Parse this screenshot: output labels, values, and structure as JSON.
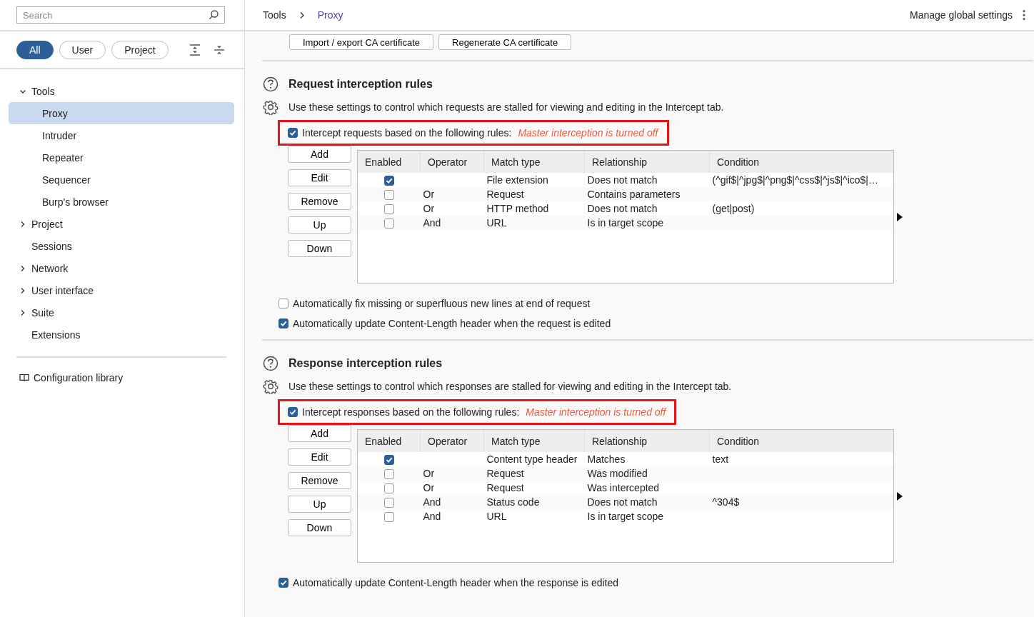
{
  "sidebar": {
    "search": {
      "placeholder": "Search"
    },
    "filters": [
      {
        "label": "All",
        "selected": true
      },
      {
        "label": "User",
        "selected": false
      },
      {
        "label": "Project",
        "selected": false
      }
    ],
    "tree": [
      {
        "label": "Tools",
        "expanded": true,
        "selected": false,
        "children": [
          {
            "label": "Proxy",
            "selected": true
          },
          {
            "label": "Intruder",
            "selected": false
          },
          {
            "label": "Repeater",
            "selected": false
          },
          {
            "label": "Sequencer",
            "selected": false
          },
          {
            "label": "Burp's browser",
            "selected": false
          }
        ]
      },
      {
        "label": "Project",
        "expanded": false,
        "selected": false
      },
      {
        "label": "Sessions",
        "selected": false
      },
      {
        "label": "Network",
        "expanded": false,
        "selected": false
      },
      {
        "label": "User interface",
        "expanded": false,
        "selected": false
      },
      {
        "label": "Suite",
        "expanded": false,
        "selected": false
      },
      {
        "label": "Extensions",
        "selected": false
      }
    ],
    "footer_link": "Configuration library"
  },
  "breadcrumb": [
    "Tools",
    "Proxy"
  ],
  "manage_link": "Manage global settings",
  "top_buttons": [
    "Import / export CA certificate",
    "Regenerate CA certificate"
  ],
  "sections": [
    {
      "title": "Request interception rules",
      "description": "Use these settings to control which requests are stalled for viewing and editing in the Intercept tab.",
      "intercept": {
        "label": "Intercept requests based on the following rules:",
        "checked": true,
        "note": "Master interception is turned off"
      },
      "buttons": [
        "Add",
        "Edit",
        "Remove",
        "Up",
        "Down"
      ],
      "columns": [
        "Enabled",
        "Operator",
        "Match type",
        "Relationship",
        "Condition"
      ],
      "rows": [
        {
          "enabled": true,
          "operator": "",
          "match_type": "File extension",
          "relationship": "Does not match",
          "condition": "(^gif$|^jpg$|^png$|^css$|^js$|^ico$|…"
        },
        {
          "enabled": false,
          "operator": "Or",
          "match_type": "Request",
          "relationship": "Contains parameters",
          "condition": ""
        },
        {
          "enabled": false,
          "operator": "Or",
          "match_type": "HTTP method",
          "relationship": "Does not match",
          "condition": "(get|post)"
        },
        {
          "enabled": false,
          "operator": "And",
          "match_type": "URL",
          "relationship": "Is in target scope",
          "condition": ""
        }
      ],
      "options": [
        {
          "label": "Automatically fix missing or superfluous new lines at end of request",
          "checked": false
        },
        {
          "label": "Automatically update Content-Length header when the request is edited",
          "checked": true
        }
      ]
    },
    {
      "title": "Response interception rules",
      "description": "Use these settings to control which responses are stalled for viewing and editing in the Intercept tab.",
      "intercept": {
        "label": "Intercept responses based on the following rules:",
        "checked": true,
        "note": "Master interception is turned off"
      },
      "buttons": [
        "Add",
        "Edit",
        "Remove",
        "Up",
        "Down"
      ],
      "columns": [
        "Enabled",
        "Operator",
        "Match type",
        "Relationship",
        "Condition"
      ],
      "rows": [
        {
          "enabled": true,
          "operator": "",
          "match_type": "Content type header",
          "relationship": "Matches",
          "condition": "text"
        },
        {
          "enabled": false,
          "operator": "Or",
          "match_type": "Request",
          "relationship": "Was modified",
          "condition": ""
        },
        {
          "enabled": false,
          "operator": "Or",
          "match_type": "Request",
          "relationship": "Was intercepted",
          "condition": ""
        },
        {
          "enabled": false,
          "operator": "And",
          "match_type": "Status code",
          "relationship": "Does not match",
          "condition": "^304$"
        },
        {
          "enabled": false,
          "operator": "And",
          "match_type": "URL",
          "relationship": "Is in target scope",
          "condition": ""
        }
      ],
      "options": [
        {
          "label": "Automatically update Content-Length header when the response is edited",
          "checked": true
        }
      ]
    }
  ]
}
